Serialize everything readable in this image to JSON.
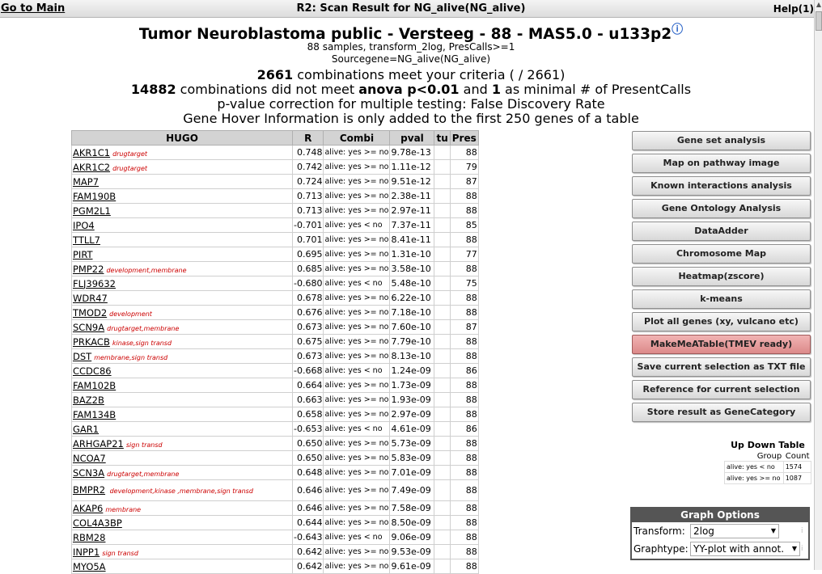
{
  "topbar": {
    "goto_main": "Go to Main",
    "title": "R2: Scan Result for NG_alive(NG_alive)",
    "help": "Help(1)"
  },
  "header": {
    "title": "Tumor Neuroblastoma public - Versteeg - 88 - MAS5.0 - u133p2",
    "samples": "88 samples, transform_2log, PresCalls>=1",
    "sourcegene": "Sourcegene=NG_alive(NG_alive)",
    "combos_count": "2661",
    "combos_text": " combinations meet your criteria ( / 2661)",
    "notmet_count": "14882",
    "notmet_text1": " combinations did not meet ",
    "notmet_bold": "anova p<0.01",
    "notmet_text2": " and ",
    "notmet_min": "1",
    "notmet_text3": " as minimal # of PresentCalls",
    "correction": "p-value correction for multiple testing: False Discovery Rate",
    "hover_info": "Gene Hover Information is only added to the first 250 genes of a table"
  },
  "table": {
    "headers": [
      "HUGO",
      "R",
      "Combi",
      "pval",
      "tu",
      "Pres"
    ],
    "rows": [
      {
        "hugo": "AKR1C1",
        "tag": "drugtarget",
        "r": "0.748",
        "combi": "alive: yes >= no",
        "pval": "9.78e-13",
        "pres": "88"
      },
      {
        "hugo": "AKR1C2",
        "tag": "drugtarget",
        "r": "0.742",
        "combi": "alive: yes >= no",
        "pval": "1.11e-12",
        "pres": "79"
      },
      {
        "hugo": "MAP7",
        "tag": "",
        "r": "0.724",
        "combi": "alive: yes >= no",
        "pval": "9.51e-12",
        "pres": "87"
      },
      {
        "hugo": "FAM190B",
        "tag": "",
        "r": "0.713",
        "combi": "alive: yes >= no",
        "pval": "2.38e-11",
        "pres": "88"
      },
      {
        "hugo": "PGM2L1",
        "tag": "",
        "r": "0.713",
        "combi": "alive: yes >= no",
        "pval": "2.97e-11",
        "pres": "88"
      },
      {
        "hugo": "IPO4",
        "tag": "",
        "r": "-0.701",
        "combi": "alive: yes < no",
        "pval": "7.37e-11",
        "pres": "85"
      },
      {
        "hugo": "TTLL7",
        "tag": "",
        "r": "0.701",
        "combi": "alive: yes >= no",
        "pval": "8.41e-11",
        "pres": "88"
      },
      {
        "hugo": "PIRT",
        "tag": "",
        "r": "0.695",
        "combi": "alive: yes >= no",
        "pval": "1.31e-10",
        "pres": "77"
      },
      {
        "hugo": "PMP22",
        "tag": "development,membrane",
        "r": "0.685",
        "combi": "alive: yes >= no",
        "pval": "3.58e-10",
        "pres": "88"
      },
      {
        "hugo": "FLJ39632",
        "tag": "",
        "r": "-0.680",
        "combi": "alive: yes < no",
        "pval": "5.48e-10",
        "pres": "75"
      },
      {
        "hugo": "WDR47",
        "tag": "",
        "r": "0.678",
        "combi": "alive: yes >= no",
        "pval": "6.22e-10",
        "pres": "88"
      },
      {
        "hugo": "TMOD2",
        "tag": "development",
        "r": "0.676",
        "combi": "alive: yes >= no",
        "pval": "7.18e-10",
        "pres": "88"
      },
      {
        "hugo": "SCN9A",
        "tag": "drugtarget,membrane",
        "r": "0.673",
        "combi": "alive: yes >= no",
        "pval": "7.60e-10",
        "pres": "87"
      },
      {
        "hugo": "PRKACB",
        "tag": "kinase,sign transd",
        "r": "0.675",
        "combi": "alive: yes >= no",
        "pval": "7.79e-10",
        "pres": "88"
      },
      {
        "hugo": "DST",
        "tag": "membrane,sign transd",
        "r": "0.673",
        "combi": "alive: yes >= no",
        "pval": "8.13e-10",
        "pres": "88"
      },
      {
        "hugo": "CCDC86",
        "tag": "",
        "r": "-0.668",
        "combi": "alive: yes < no",
        "pval": "1.24e-09",
        "pres": "86"
      },
      {
        "hugo": "FAM102B",
        "tag": "",
        "r": "0.664",
        "combi": "alive: yes >= no",
        "pval": "1.73e-09",
        "pres": "88"
      },
      {
        "hugo": "BAZ2B",
        "tag": "",
        "r": "0.663",
        "combi": "alive: yes >= no",
        "pval": "1.93e-09",
        "pres": "88"
      },
      {
        "hugo": "FAM134B",
        "tag": "",
        "r": "0.658",
        "combi": "alive: yes >= no",
        "pval": "2.97e-09",
        "pres": "88"
      },
      {
        "hugo": "GAR1",
        "tag": "",
        "r": "-0.653",
        "combi": "alive: yes < no",
        "pval": "4.61e-09",
        "pres": "86"
      },
      {
        "hugo": "ARHGAP21",
        "tag": "sign transd",
        "r": "0.650",
        "combi": "alive: yes >= no",
        "pval": "5.73e-09",
        "pres": "88"
      },
      {
        "hugo": "NCOA7",
        "tag": "",
        "r": "0.650",
        "combi": "alive: yes >= no",
        "pval": "5.83e-09",
        "pres": "88"
      },
      {
        "hugo": "SCN3A",
        "tag": "drugtarget,membrane",
        "r": "0.648",
        "combi": "alive: yes >= no",
        "pval": "7.01e-09",
        "pres": "88"
      },
      {
        "hugo": "BMPR2",
        "tag": "development,kinase ,membrane,sign transd",
        "r": "0.646",
        "combi": "alive: yes >= no",
        "pval": "7.49e-09",
        "pres": "88",
        "tall": true
      },
      {
        "hugo": "AKAP6",
        "tag": "membrane",
        "r": "0.646",
        "combi": "alive: yes >= no",
        "pval": "7.58e-09",
        "pres": "88"
      },
      {
        "hugo": "COL4A3BP",
        "tag": "",
        "r": "0.644",
        "combi": "alive: yes >= no",
        "pval": "8.50e-09",
        "pres": "88"
      },
      {
        "hugo": "RBM28",
        "tag": "",
        "r": "-0.643",
        "combi": "alive: yes < no",
        "pval": "9.06e-09",
        "pres": "88"
      },
      {
        "hugo": "INPP1",
        "tag": "sign transd",
        "r": "0.642",
        "combi": "alive: yes >= no",
        "pval": "9.53e-09",
        "pres": "88"
      },
      {
        "hugo": "MYO5A",
        "tag": "",
        "r": "0.642",
        "combi": "alive: yes >= no",
        "pval": "9.61e-09",
        "pres": "88"
      }
    ]
  },
  "buttons": [
    "Gene set analysis",
    "Map on pathway image",
    "Known interactions analysis",
    "Gene Ontology Analysis",
    "DataAdder",
    "Chromosome Map",
    "Heatmap(zscore)",
    "k-means",
    "Plot all genes (xy, vulcano etc)",
    "MakeMeATable(TMEV ready)",
    "Save current selection as TXT file",
    "Reference for current selection",
    "Store result as GeneCategory"
  ],
  "updown": {
    "title": "Up Down Table",
    "col_group": "Group",
    "col_count": "Count",
    "rows": [
      {
        "group": "alive: yes < no",
        "count": "1574"
      },
      {
        "group": "alive: yes >= no",
        "count": "1087"
      }
    ]
  },
  "graph_options": {
    "title": "Graph Options",
    "transform_label": "Transform:",
    "transform_value": "2log",
    "graphtype_label": "Graphtype:",
    "graphtype_value": "YY-plot with annot."
  },
  "colors": {
    "tag_red": "#cc0000",
    "highlight_button": "#e39a9a",
    "graph_header": "#555555"
  }
}
